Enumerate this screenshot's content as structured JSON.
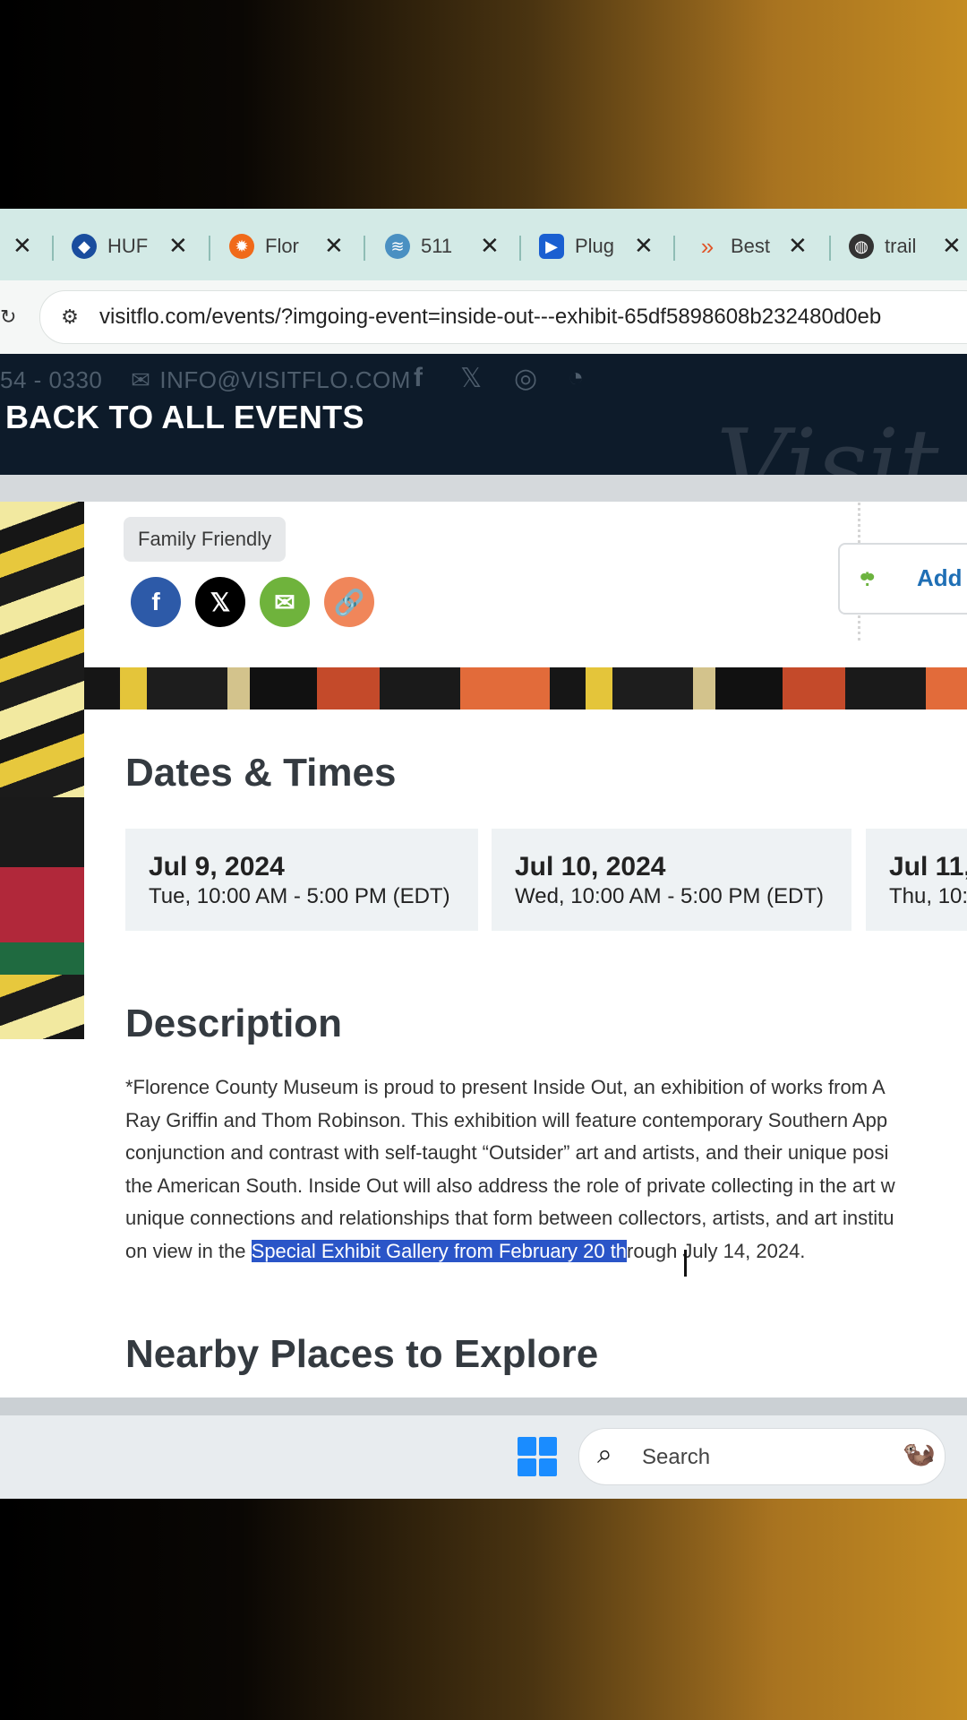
{
  "browser": {
    "tabs": [
      {
        "title": "HUF",
        "icon": "noaa-icon",
        "color": "#1a4d9e"
      },
      {
        "title": "Flor",
        "icon": "sun-icon",
        "color": "#f06a1a"
      },
      {
        "title": "511",
        "icon": "road-icon",
        "color": "#4a90c2"
      },
      {
        "title": "Plug",
        "icon": "plugin-icon",
        "color": "#1a5fd1"
      },
      {
        "title": "Best",
        "icon": "arrow-icon",
        "color": "#e0562a"
      },
      {
        "title": "trail",
        "icon": "globe-icon",
        "color": "#333333"
      }
    ],
    "url": "visitflo.com/events/?imgoing-event=inside-out---exhibit-65df5898608b232480d0eb"
  },
  "site_header": {
    "phone": "54 - 0330",
    "email": "INFO@VISITFLO.COM",
    "back_link": "BACK TO ALL EVENTS",
    "watermark": "Visit"
  },
  "event": {
    "tag": "Family Friendly",
    "add_label": "Add",
    "dates_heading": "Dates & Times",
    "dates": [
      {
        "date": "Jul 9, 2024",
        "time": "Tue, 10:00 AM - 5:00 PM (EDT)"
      },
      {
        "date": "Jul 10, 2024",
        "time": "Wed, 10:00 AM - 5:00 PM (EDT)"
      },
      {
        "date": "Jul 11,",
        "time": "Thu, 10:"
      }
    ],
    "description_heading": "Description",
    "description_lines": [
      "*Florence County Museum is proud to present Inside Out, an exhibition of works from A",
      "Ray Griffin and Thom Robinson. This exhibition will feature contemporary Southern App",
      "conjunction and contrast with self-taught “Outsider” art and artists, and their unique posi",
      "the American South. Inside Out will also address the role of private collecting in the art w",
      "unique connections and relationships that form between collectors, artists, and art institu"
    ],
    "description_last": {
      "before": "on view in the ",
      "highlight": "Special Exhibit Gallery from February 20 th",
      "after": "rough July 14, 2024."
    },
    "nearby_heading": "Nearby Places to Explore"
  },
  "taskbar": {
    "search_placeholder": "Search"
  }
}
